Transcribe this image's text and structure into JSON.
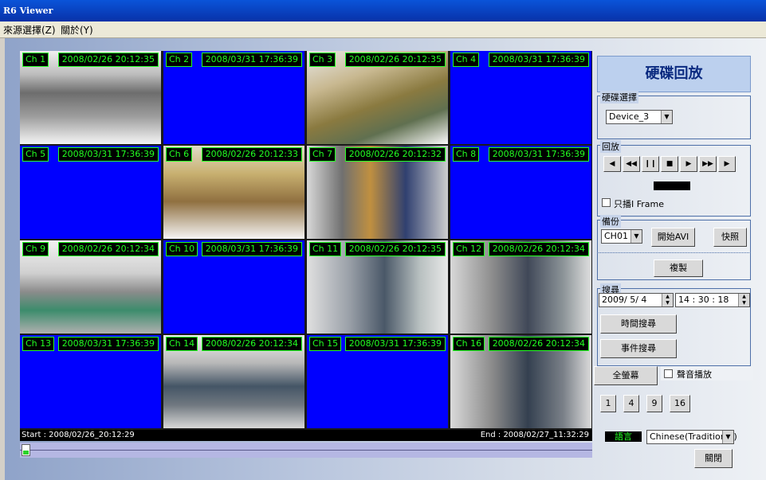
{
  "window": {
    "title": "R6 Viewer"
  },
  "menu": {
    "items": [
      "來源選擇(Z)",
      "關於(Y)"
    ]
  },
  "channels": [
    {
      "ch": "Ch 1",
      "ts": "2008/02/26  20:12:35",
      "video": true
    },
    {
      "ch": "Ch 2",
      "ts": "2008/03/31  17:36:39",
      "video": false
    },
    {
      "ch": "Ch 3",
      "ts": "2008/02/26  20:12:35",
      "video": true
    },
    {
      "ch": "Ch 4",
      "ts": "2008/03/31  17:36:39",
      "video": false
    },
    {
      "ch": "Ch 5",
      "ts": "2008/03/31  17:36:39",
      "video": false
    },
    {
      "ch": "Ch 6",
      "ts": "2008/02/26  20:12:33",
      "video": true
    },
    {
      "ch": "Ch 7",
      "ts": "2008/02/26  20:12:32",
      "video": true
    },
    {
      "ch": "Ch 8",
      "ts": "2008/03/31  17:36:39",
      "video": false
    },
    {
      "ch": "Ch 9",
      "ts": "2008/02/26  20:12:34",
      "video": true
    },
    {
      "ch": "Ch 10",
      "ts": "2008/03/31  17:36:39",
      "video": false
    },
    {
      "ch": "Ch 11",
      "ts": "2008/02/26  20:12:35",
      "video": true
    },
    {
      "ch": "Ch 12",
      "ts": "2008/02/26  20:12:34",
      "video": true
    },
    {
      "ch": "Ch 13",
      "ts": "2008/03/31  17:36:39",
      "video": false
    },
    {
      "ch": "Ch 14",
      "ts": "2008/02/26  20:12:34",
      "video": true
    },
    {
      "ch": "Ch 15",
      "ts": "2008/03/31  17:36:39",
      "video": false
    },
    {
      "ch": "Ch 16",
      "ts": "2008/02/26  20:12:34",
      "video": true
    }
  ],
  "timeline": {
    "start": "Start : 2008/02/26_20:12:29",
    "end": "End : 2008/02/27_11:32:29",
    "position": 0.0
  },
  "panel": {
    "title": "硬碟回放",
    "disk": {
      "label": "硬碟選擇",
      "value": "Device_3"
    },
    "playback": {
      "label": "回放",
      "buttons": [
        "step-back",
        "rewind",
        "pause",
        "stop",
        "play",
        "fast-forward",
        "step-forward"
      ],
      "only_iframe": "只播I Frame"
    },
    "backup": {
      "label": "備份",
      "channel": "CH01",
      "start_avi": "開始AVI",
      "snapshot": "快照",
      "copy": "複製"
    },
    "search": {
      "label": "搜尋",
      "date": "2009/ 5/ 4",
      "time": "14 : 30 : 18",
      "time_search": "時間搜尋",
      "event_search": "事件搜尋"
    },
    "fullscreen": "全螢幕",
    "audio": "聲音播放",
    "layouts": [
      "1",
      "4",
      "9",
      "16"
    ],
    "language": {
      "label": "語言",
      "value": "Chinese(Traditional)"
    },
    "close": "關閉"
  },
  "colors": {
    "channel_bg": "#0000ff",
    "label_green": "#22ff22",
    "title_blue": "#0a2a80"
  }
}
